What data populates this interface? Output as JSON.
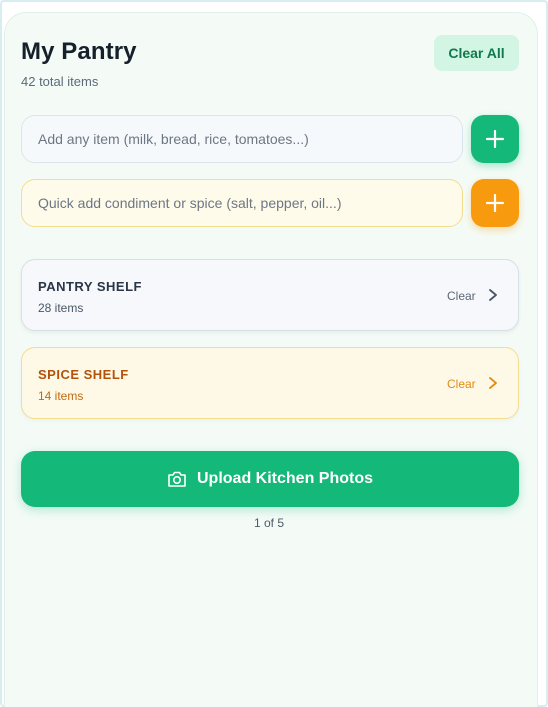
{
  "header": {
    "title": "My Pantry",
    "subtitle": "42 total items",
    "clear_all_label": "Clear All"
  },
  "inputs": {
    "item": {
      "placeholder": "Add any item (milk, bread, rice, tomatoes...)",
      "value": ""
    },
    "spice": {
      "placeholder": "Quick add condiment or spice (salt, pepper, oil...)",
      "value": ""
    },
    "add_icon": "plus-icon"
  },
  "shelves": [
    {
      "name": "PANTRY SHELF",
      "count": "28 items",
      "clear_label": "Clear",
      "accent": "#2a3646"
    },
    {
      "name": "SPICE SHELF",
      "count": "14 items",
      "clear_label": "Clear",
      "accent": "#b4520a"
    }
  ],
  "upload": {
    "label": "Upload Kitchen Photos",
    "icon": "camera-icon"
  },
  "pager": {
    "text": "1 of 5"
  },
  "colors": {
    "primary": "#14b879",
    "spice_accent": "#f79a0d",
    "background": "#f4fbf7"
  }
}
